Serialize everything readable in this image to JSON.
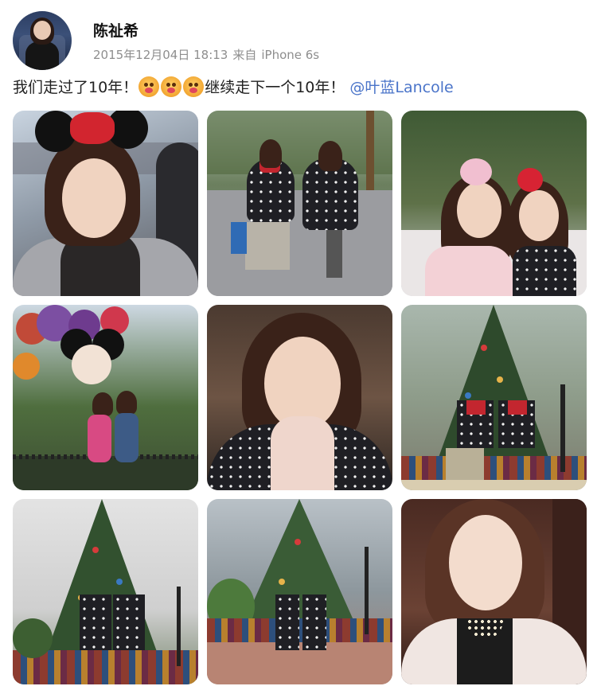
{
  "post": {
    "author": "陈祉希",
    "date": "2015年12月04日 18:13",
    "source_prefix": "来自",
    "source_device": "iPhone 6s",
    "text_before": "我们走过了10年！",
    "text_after": "继续走下一个10年！",
    "mention": "@叶蓝Lancole",
    "emojis": [
      "sad-face-emoji",
      "sad-face-emoji",
      "sad-face-emoji"
    ]
  },
  "photos": [
    {
      "label": "selfie-with-minnie-ears"
    },
    {
      "label": "walking-in-polka-dot-capes"
    },
    {
      "label": "two-friends-with-minnie-ears"
    },
    {
      "label": "minnie-balloons-park"
    },
    {
      "label": "selfie-with-scarf"
    },
    {
      "label": "christmas-tree-back-view"
    },
    {
      "label": "christmas-tree-hug"
    },
    {
      "label": "christmas-tree-hug-wide"
    },
    {
      "label": "portrait-white-coat"
    }
  ],
  "colors": {
    "accent_link": "#4a74c9",
    "meta_gray": "#8e8e8e"
  }
}
